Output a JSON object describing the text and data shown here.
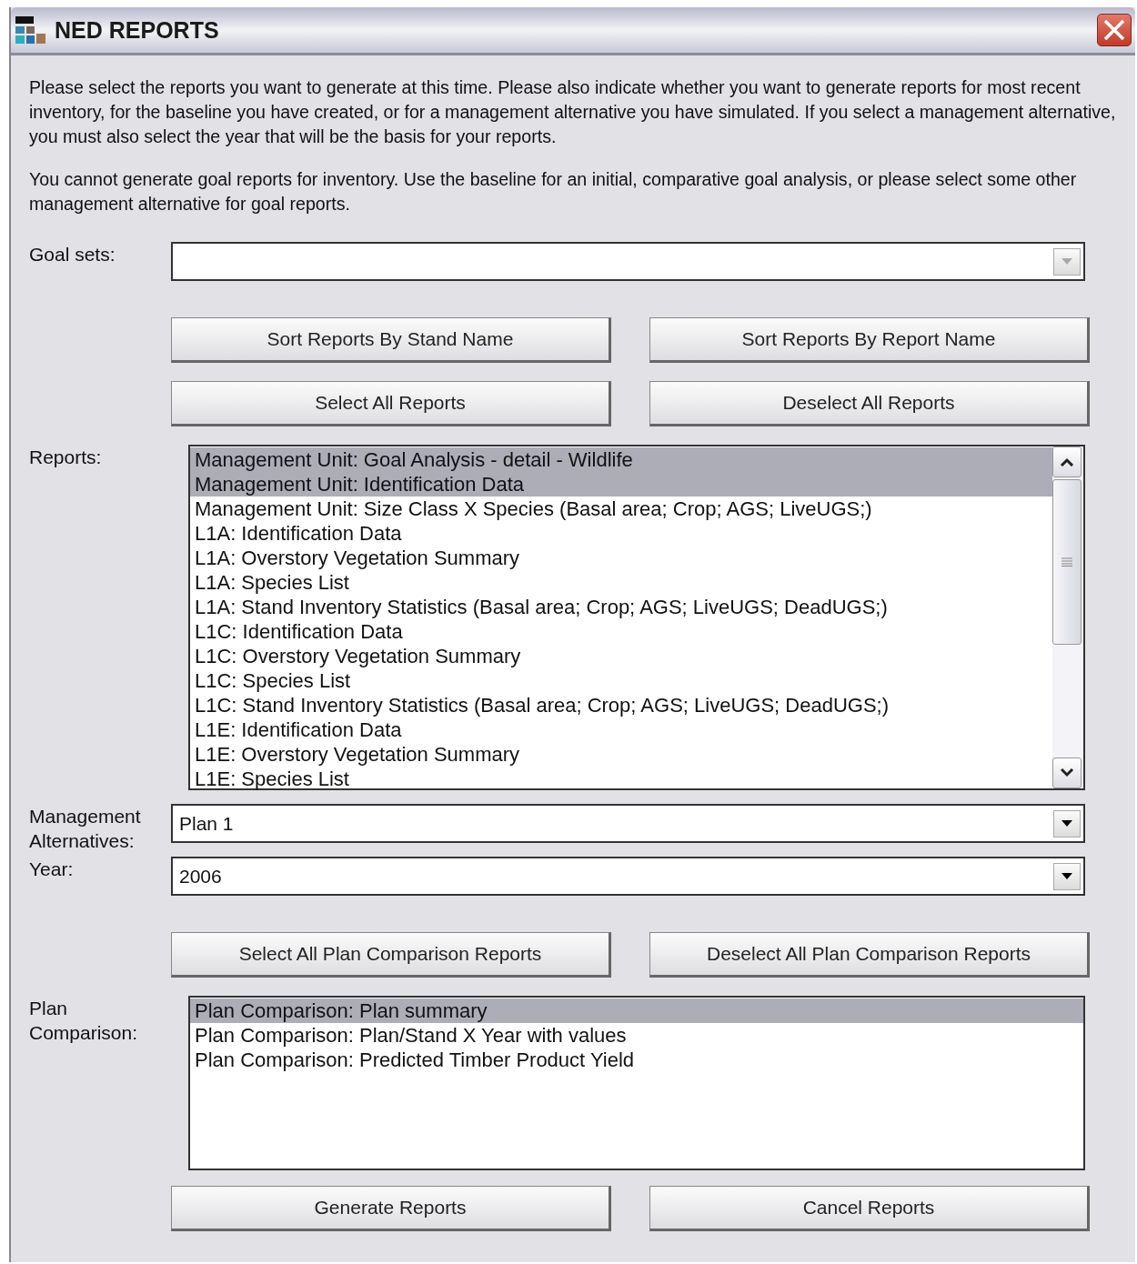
{
  "window": {
    "title": "NED REPORTS"
  },
  "intro": [
    "Please select the reports you want to generate at this time. Please also indicate whether you want to generate reports for most recent inventory, for the baseline you have created, or for a management alternative you have simulated. If you select a management alternative, you must also select the year that will be the basis for your reports.",
    "You cannot generate goal reports for inventory. Use the baseline for an initial, comparative goal analysis, or please select some other management alternative for goal reports."
  ],
  "goal_sets": {
    "label": "Goal sets:",
    "disabled": true
  },
  "sort_buttons": [
    "Sort Reports By Stand Name",
    "Sort Reports By Report Name"
  ],
  "select_buttons": [
    "Select All Reports",
    "Deselect All Reports"
  ],
  "reports": {
    "label": "Reports:",
    "items": [
      {
        "text": "Management Unit: Goal Analysis - detail - Wildlife",
        "selected": true
      },
      {
        "text": "Management Unit: Identification Data",
        "selected": true
      },
      {
        "text": "Management Unit: Size Class X Species (Basal area; Crop; AGS; LiveUGS;)",
        "selected": false
      },
      {
        "text": "L1A: Identification Data",
        "selected": false
      },
      {
        "text": "L1A: Overstory Vegetation Summary",
        "selected": false
      },
      {
        "text": "L1A: Species List",
        "selected": false
      },
      {
        "text": "L1A: Stand Inventory Statistics (Basal area; Crop; AGS; LiveUGS; DeadUGS;)",
        "selected": false
      },
      {
        "text": "L1C: Identification Data",
        "selected": false
      },
      {
        "text": "L1C: Overstory Vegetation Summary",
        "selected": false
      },
      {
        "text": "L1C: Species List",
        "selected": false
      },
      {
        "text": "L1C: Stand Inventory Statistics (Basal area; Crop; AGS; LiveUGS; DeadUGS;)",
        "selected": false
      },
      {
        "text": "L1E: Identification Data",
        "selected": false
      },
      {
        "text": "L1E: Overstory Vegetation Summary",
        "selected": false
      },
      {
        "text": "L1E: Species List",
        "selected": false
      }
    ]
  },
  "management_alternatives": {
    "label": "Management Alternatives:",
    "value": "Plan 1",
    "disabled": false
  },
  "year": {
    "label": "Year:",
    "value": "2006",
    "disabled": false
  },
  "plan_buttons": [
    "Select All Plan Comparison Reports",
    "Deselect All Plan Comparison Reports"
  ],
  "plan_comparison": {
    "label": "Plan Comparison:",
    "items": [
      {
        "text": "Plan Comparison: Plan summary",
        "selected": true
      },
      {
        "text": "Plan Comparison: Plan/Stand X Year with values",
        "selected": false
      },
      {
        "text": "Plan Comparison: Predicted Timber Product Yield",
        "selected": false
      }
    ]
  },
  "footer_buttons": [
    "Generate Reports",
    "Cancel Reports"
  ]
}
